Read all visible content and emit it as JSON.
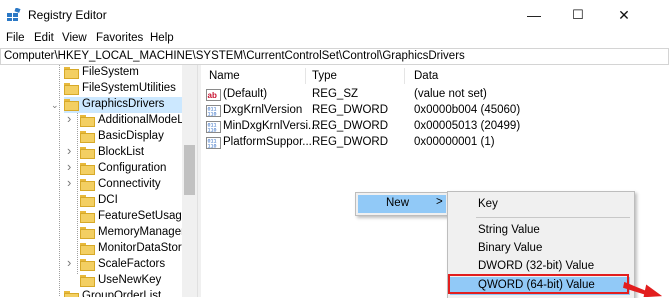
{
  "window": {
    "title": "Registry Editor",
    "controls": {
      "minimize": "—",
      "maximize": "☐",
      "close": "✕"
    }
  },
  "menubar": {
    "items": [
      "File",
      "Edit",
      "View",
      "Favorites",
      "Help"
    ]
  },
  "address": {
    "path": "Computer\\HKEY_LOCAL_MACHINE\\SYSTEM\\CurrentControlSet\\Control\\GraphicsDrivers"
  },
  "tree": {
    "items": [
      {
        "label": "FileSystem",
        "expander": "none"
      },
      {
        "label": "FileSystemUtilities",
        "expander": "none"
      },
      {
        "label": "GraphicsDrivers",
        "expander": "expanded",
        "selected": true
      },
      {
        "label": "AdditionalModeLis",
        "expander": "collapsed"
      },
      {
        "label": "BasicDisplay",
        "expander": "none"
      },
      {
        "label": "BlockList",
        "expander": "collapsed"
      },
      {
        "label": "Configuration",
        "expander": "collapsed"
      },
      {
        "label": "Connectivity",
        "expander": "collapsed"
      },
      {
        "label": "DCI",
        "expander": "none"
      },
      {
        "label": "FeatureSetUsage",
        "expander": "none"
      },
      {
        "label": "MemoryManager",
        "expander": "none"
      },
      {
        "label": "MonitorDataStore",
        "expander": "none"
      },
      {
        "label": "ScaleFactors",
        "expander": "collapsed"
      },
      {
        "label": "UseNewKey",
        "expander": "none"
      },
      {
        "label": "GroupOrderList",
        "expander": "none"
      }
    ]
  },
  "list": {
    "headers": {
      "name": "Name",
      "type": "Type",
      "data": "Data"
    },
    "rows": [
      {
        "icon": "string-value-icon",
        "name": "(Default)",
        "type": "REG_SZ",
        "data": "(value not set)"
      },
      {
        "icon": "binary-value-icon",
        "name": "DxgKrnlVersion",
        "type": "REG_DWORD",
        "data": "0x0000b004 (45060)"
      },
      {
        "icon": "binary-value-icon",
        "name": "MinDxgKrnlVersi...",
        "type": "REG_DWORD",
        "data": "0x00005013 (20499)"
      },
      {
        "icon": "binary-value-icon",
        "name": "PlatformSuppor...",
        "type": "REG_DWORD",
        "data": "0x00000001 (1)"
      }
    ]
  },
  "context_menu": {
    "new_label": "New",
    "new_arrow": ">",
    "submenu": {
      "key": "Key",
      "items": [
        "String Value",
        "Binary Value",
        "DWORD (32-bit) Value",
        "QWORD (64-bit) Value"
      ],
      "highlighted": "QWORD (64-bit) Value"
    }
  },
  "colors": {
    "selection": "#cce8ff",
    "menu_highlight": "#91c9f7",
    "annotation_red": "#e21e1e",
    "folder_yellow": "#f3cf62"
  }
}
